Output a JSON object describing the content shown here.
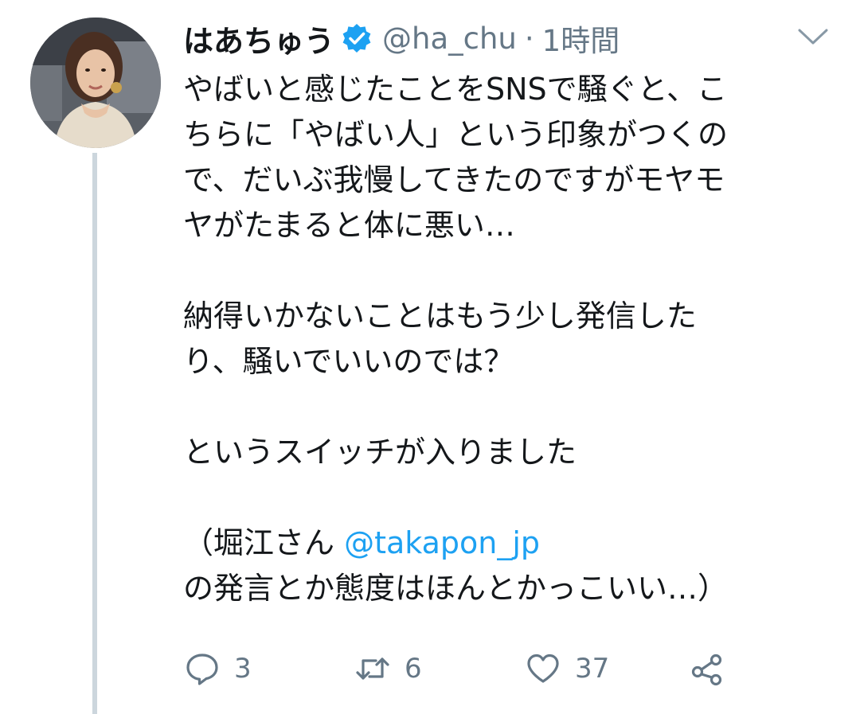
{
  "tweet": {
    "display_name": "はあちゅう",
    "handle": "@ha_chu",
    "separator": "·",
    "time": "1時間",
    "verified_icon": "verified-badge-icon",
    "caret_icon": "chevron-down-icon",
    "avatar_icon": "user-avatar",
    "lines": {
      "l1": "やばいと感じたことをSNSで騒ぐと、こ",
      "l2": "ちらに「やばい人」という印象がつくの",
      "l3": "で、だいぶ我慢してきたのですがモヤモ",
      "l4": "ヤがたまると体に悪い…",
      "l5": "納得いかないことはもう少し発信した",
      "l6": "り、騒いでいいのでは？",
      "l7": "というスイッチが入りました",
      "l8_prefix": "（堀江さん ",
      "l8_mention": "@takapon_jp",
      "l9": "の発言とか態度はほんとかっこいい…）"
    },
    "actions": {
      "reply": {
        "icon": "reply-icon",
        "count": "3"
      },
      "retweet": {
        "icon": "retweet-icon",
        "count": "6"
      },
      "like": {
        "icon": "heart-icon",
        "count": "37"
      },
      "share": {
        "icon": "share-icon"
      }
    },
    "colors": {
      "text": "#14171a",
      "secondary": "#657786",
      "link": "#1da1f2",
      "verified": "#1da1f2",
      "thread_line": "#ccd6dd"
    }
  }
}
